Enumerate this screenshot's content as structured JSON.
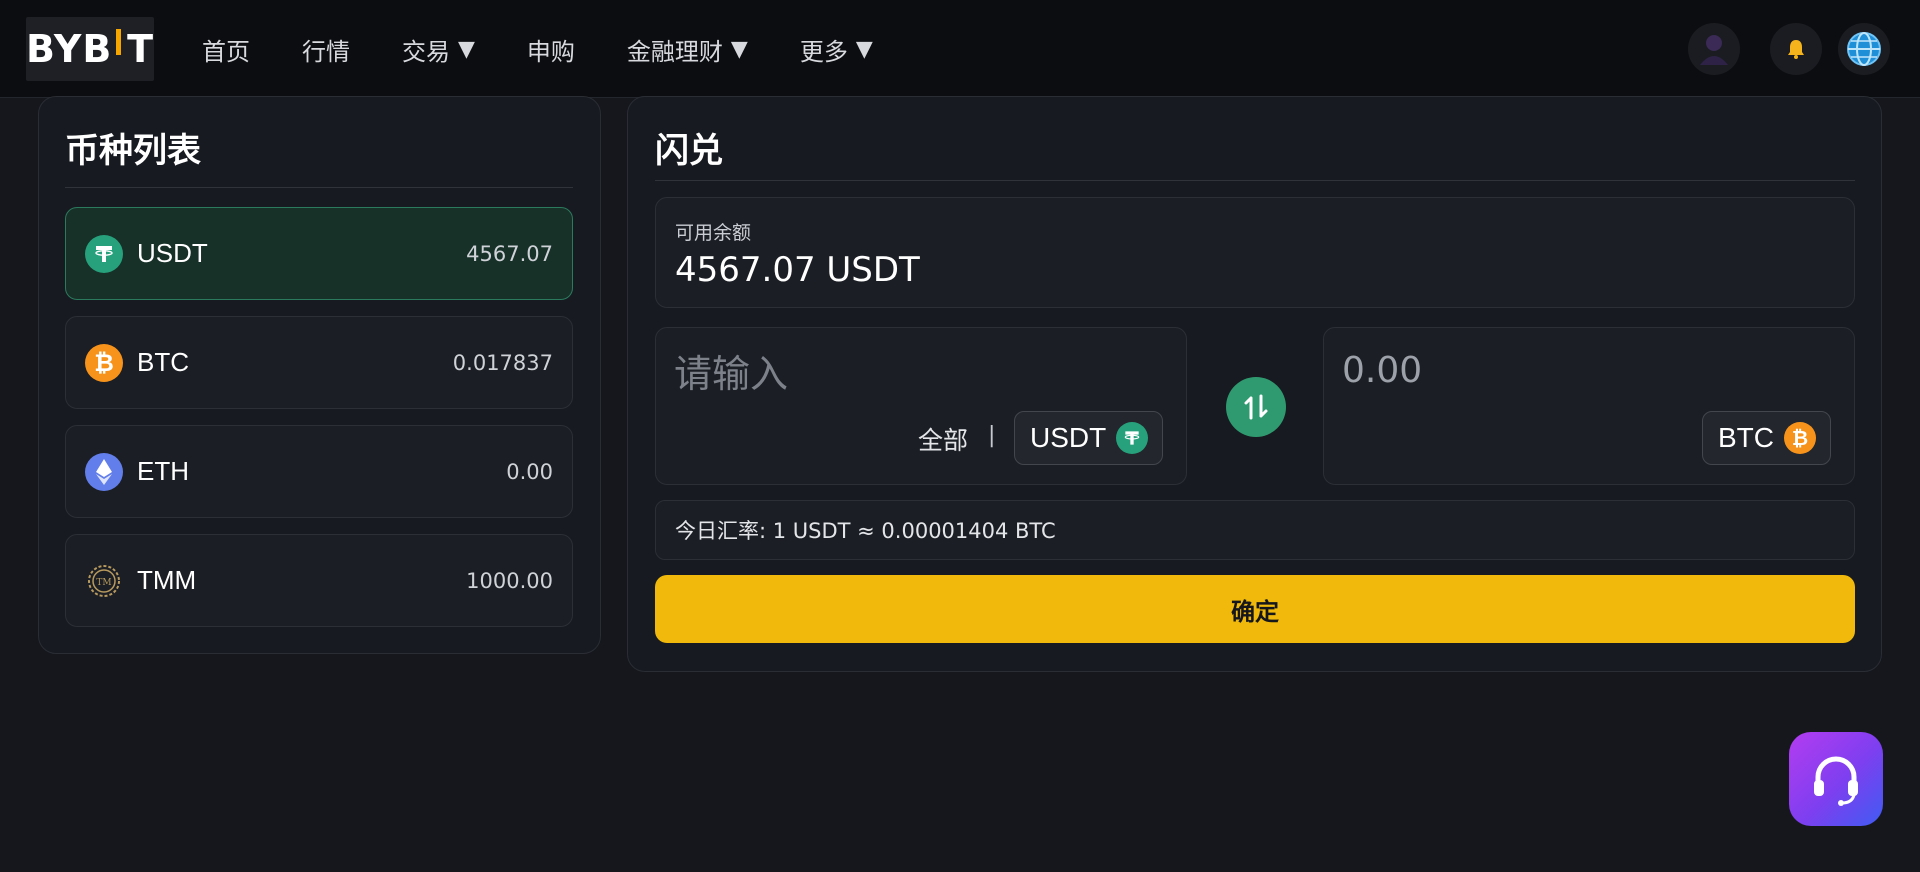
{
  "brand": {
    "logo_text_left": "BYB",
    "logo_text_right": "T",
    "accent": "#f7a600"
  },
  "nav": {
    "items": [
      {
        "label": "首页",
        "has_dropdown": false
      },
      {
        "label": "行情",
        "has_dropdown": false
      },
      {
        "label": "交易",
        "has_dropdown": true
      },
      {
        "label": "申购",
        "has_dropdown": false
      },
      {
        "label": "金融理财",
        "has_dropdown": true
      },
      {
        "label": "更多",
        "has_dropdown": true
      }
    ],
    "caret": "▼",
    "icons": [
      "avatar-icon",
      "bell-icon",
      "globe-icon"
    ]
  },
  "coin_list": {
    "title": "币种列表",
    "items": [
      {
        "symbol": "USDT",
        "amount": "4567.07",
        "icon": "usdt-icon",
        "color": "#26a17b",
        "active": true
      },
      {
        "symbol": "BTC",
        "amount": "0.017837",
        "icon": "btc-icon",
        "color": "#f7931a",
        "active": false
      },
      {
        "symbol": "ETH",
        "amount": "0.00",
        "icon": "eth-icon",
        "color": "#627eea",
        "active": false
      },
      {
        "symbol": "TMM",
        "amount": "1000.00",
        "icon": "tmm-icon",
        "color": "#b89a5e",
        "active": false
      }
    ]
  },
  "swap": {
    "title": "闪兑",
    "balance_label": "可用余额",
    "balance_value": "4567.07 USDT",
    "from": {
      "placeholder": "请输入",
      "value": "",
      "all_label": "全部",
      "separator": "|",
      "token": "USDT"
    },
    "to": {
      "value": "0.00",
      "token": "BTC"
    },
    "rate_text": "今日汇率: 1 USDT ≈ 0.00001404 BTC",
    "confirm_label": "确定",
    "confirm_color": "#f0b90b",
    "toggle_color": "#2f9a6f"
  },
  "support": {
    "icon": "headset-icon"
  }
}
